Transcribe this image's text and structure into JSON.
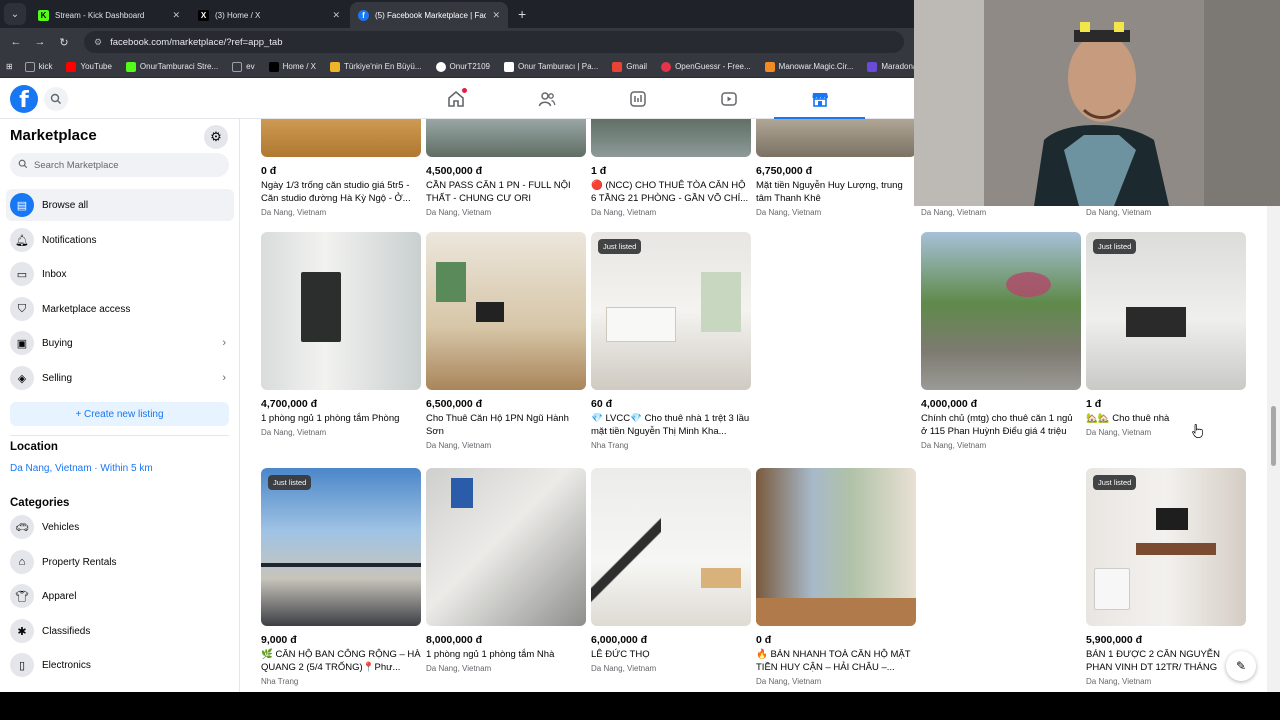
{
  "browser": {
    "tabs": [
      {
        "title": "Stream - Kick Dashboard",
        "fav": "K",
        "fav_color": "#53fc18",
        "active": false
      },
      {
        "title": "(3) Home / X",
        "fav": "X",
        "fav_color": "#000000",
        "active": false
      },
      {
        "title": "(5) Facebook Marketplace | Fac",
        "fav": "f",
        "fav_color": "#1877f2",
        "active": true
      }
    ],
    "url": "facebook.com/marketplace/?ref=app_tab",
    "bookmarks": [
      {
        "label": "kick",
        "color": "#9aa0a6"
      },
      {
        "label": "YouTube",
        "color": "#ff0000"
      },
      {
        "label": "OnurTamburaci Stre...",
        "color": "#53fc18"
      },
      {
        "label": "ev",
        "color": "#9aa0a6"
      },
      {
        "label": "Home / X",
        "color": "#000000"
      },
      {
        "label": "Türkiye'nin En Büyü...",
        "color": "#f0b429"
      },
      {
        "label": "OnurT2109",
        "color": "#ffffff"
      },
      {
        "label": "Onur Tamburacı | Pa...",
        "color": "#ffffff"
      },
      {
        "label": "Gmail",
        "color": "#ea4335"
      },
      {
        "label": "OpenGuessr - Free...",
        "color": "#e8334a"
      },
      {
        "label": "Manowar.Magic.Cir...",
        "color": "#f28b24"
      },
      {
        "label": "Maradona: B",
        "color": "#6a4bd6"
      }
    ]
  },
  "sidebar": {
    "title": "Marketplace",
    "search_placeholder": "Search Marketplace",
    "items": [
      {
        "label": "Browse all",
        "icon": "storefront-icon",
        "active": true
      },
      {
        "label": "Notifications",
        "icon": "bell-icon"
      },
      {
        "label": "Inbox",
        "icon": "inbox-icon"
      },
      {
        "label": "Marketplace access",
        "icon": "shield-icon"
      },
      {
        "label": "Buying",
        "icon": "bag-icon",
        "chevron": true
      },
      {
        "label": "Selling",
        "icon": "tag-icon",
        "chevron": true
      }
    ],
    "create_label": "+ Create new listing",
    "location_heading": "Location",
    "location_value": "Da Nang, Vietnam · Within 5 km",
    "categories_heading": "Categories",
    "categories": [
      {
        "label": "Vehicles",
        "icon": "car-icon"
      },
      {
        "label": "Property Rentals",
        "icon": "house-icon"
      },
      {
        "label": "Apparel",
        "icon": "shirt-icon"
      },
      {
        "label": "Classifieds",
        "icon": "classifieds-icon"
      },
      {
        "label": "Electronics",
        "icon": "phone-icon"
      }
    ]
  },
  "listings": {
    "row1": [
      {
        "price": "0 đ",
        "title": "Ngày 1/3 trống căn studio giá 5tr5 - Căn studio đường Hà Kỳ Ngộ - Ở...",
        "loc": "Da Nang, Vietnam"
      },
      {
        "price": "4,500,000 đ",
        "title": "CẦN PASS CĂN 1 PN - FULL NỘI THẤT - CHUNG CƯ ORI",
        "loc": "Da Nang, Vietnam"
      },
      {
        "price": "1 đ",
        "title": "🔴 (NCC) CHO THUÊ TÒA CĂN HỘ 6 TẦNG 21 PHÒNG - GẦN VÕ CHÍ...",
        "loc": "Da Nang, Vietnam"
      },
      {
        "price": "6,750,000 đ",
        "title": "Mặt tiền Nguyễn Huy Lượng, trung tâm Thanh Khê",
        "loc": "Da Nang, Vietnam"
      },
      {
        "price": "",
        "title": "",
        "loc": "Da Nang, Vietnam"
      },
      {
        "price": "",
        "title": "",
        "loc": "Da Nang, Vietnam"
      }
    ],
    "row2": [
      {
        "price": "4,700,000 đ",
        "title": "1 phòng ngủ 1 phòng tắm Phòng",
        "loc": "Da Nang, Vietnam",
        "badge": ""
      },
      {
        "price": "6,500,000 đ",
        "title": "Cho Thuê Căn Hộ 1PN Ngũ Hành Sơn",
        "loc": "Da Nang, Vietnam",
        "badge": ""
      },
      {
        "price": "60 đ",
        "title": "💎 LVCC💎 Cho thuê nhà 1 trệt 3 lầu mặt tiền Nguyễn Thị Minh Kha...",
        "loc": "Nha Trang",
        "badge": "Just listed"
      },
      {
        "price": "4,000,000 đ",
        "title": "Chính chủ (mtg) cho thuê căn 1 ngủ ở 115 Phan Huỳnh Điểu giá 4 triệu",
        "loc": "Da Nang, Vietnam",
        "badge": ""
      },
      {
        "price": "1 đ",
        "title": "🏡🏡 Cho thuê nhà",
        "loc": "Da Nang, Vietnam",
        "badge": "Just listed"
      }
    ],
    "row3": [
      {
        "price": "9,000 đ",
        "title": "🌿 CĂN HỘ BAN CÔNG RỘNG – HÀ QUANG 2 (5/4 TRỐNG)📍Phư...",
        "loc": "Nha Trang",
        "badge": "Just listed"
      },
      {
        "price": "8,000,000 đ",
        "title": "1 phòng ngủ 1 phòng tắm Nhà",
        "loc": "Da Nang, Vietnam",
        "badge": ""
      },
      {
        "price": "6,000,000 đ",
        "title": "LÊ ĐỨC THỌ",
        "loc": "Da Nang, Vietnam",
        "badge": ""
      },
      {
        "price": "0 đ",
        "title": "🔥 BÁN NHANH TOÀ CĂN HỘ MẶT TIỀN HUY CẬN – HẢI CHÂU –...",
        "loc": "Da Nang, Vietnam",
        "badge": ""
      },
      {
        "price": "5,900,000 đ",
        "title": "BÁN 1 ĐƯỢC 2 CĂN NGUYỄN PHAN VINH DT 12TR/ THÁNG",
        "loc": "Da Nang, Vietnam",
        "badge": "Just listed"
      }
    ]
  }
}
